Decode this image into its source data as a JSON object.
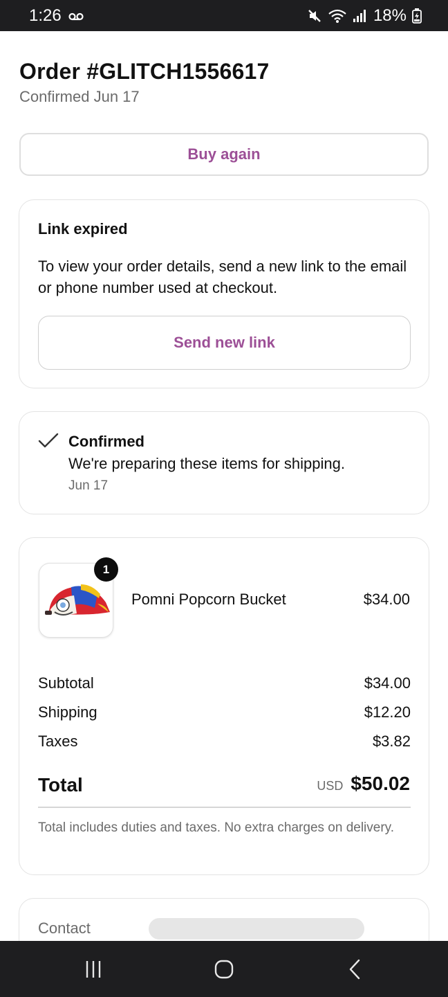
{
  "status_bar": {
    "time": "1:26",
    "voicemail_icon": "voicemail-icon",
    "mute_icon": "mute-icon",
    "wifi_icon": "wifi-icon",
    "signal_icon": "signal-icon",
    "battery_percent": "18%",
    "battery_icon": "battery-charging-icon"
  },
  "order": {
    "title": "Order #GLITCH1556617",
    "subtitle": "Confirmed Jun 17",
    "buy_again_label": "Buy again"
  },
  "link_card": {
    "title": "Link expired",
    "body": "To view your order details, send a new link to the email or phone number used at checkout.",
    "button_label": "Send new link"
  },
  "status_card": {
    "icon": "checkmark-icon",
    "title": "Confirmed",
    "description": "We're preparing these items for shipping.",
    "date": "Jun 17"
  },
  "items_card": {
    "items": [
      {
        "name": "Pomni Popcorn Bucket",
        "price": "$34.00",
        "quantity": "1"
      }
    ],
    "summary": [
      {
        "label": "Subtotal",
        "value": "$34.00"
      },
      {
        "label": "Shipping",
        "value": "$12.20"
      },
      {
        "label": "Taxes",
        "value": "$3.82"
      }
    ],
    "total_label": "Total",
    "total_currency": "USD",
    "total_value": "$50.02",
    "note": "Total includes duties and taxes. No extra charges on delivery."
  },
  "contact_card": {
    "label": "Contact"
  },
  "nav_bar": {
    "recents_icon": "recents-icon",
    "home_icon": "home-icon",
    "back_icon": "back-icon"
  },
  "colors": {
    "accent": "#9c4f96",
    "system_bar": "#1e1e20",
    "muted_text": "#6b6b6b",
    "border": "#e3e3e3"
  }
}
